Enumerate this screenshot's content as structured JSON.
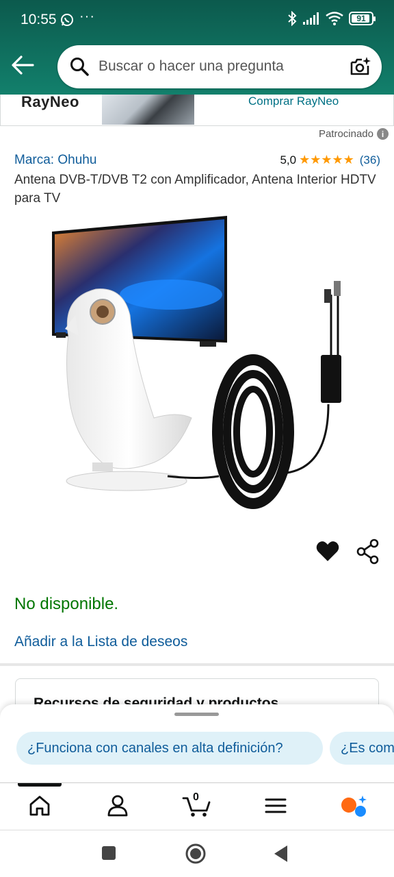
{
  "status": {
    "time": "10:55",
    "dots": "···",
    "battery": "91"
  },
  "search": {
    "placeholder": "Buscar o hacer una pregunta"
  },
  "ad": {
    "brand_logo": "RayNeo",
    "shop_link": "Comprar RayNeo"
  },
  "sponsored": {
    "label": "Patrocinado",
    "info": "i"
  },
  "product": {
    "brand": "Marca: Ohuhu",
    "rating_value": "5,0",
    "stars": "★★★★★",
    "rating_count": "(36)",
    "title": "Antena DVB-T/DVB T2 con Amplificador, Antena Interior HDTV para TV",
    "availability": "No disponible.",
    "wishlist": "Añadir a la Lista de deseos"
  },
  "card": {
    "title": "Recursos de seguridad y productos"
  },
  "suggestions": [
    "¿Funciona con canales en alta definición?",
    "¿Es com"
  ],
  "nav": {
    "cart_count": "0"
  },
  "colors": {
    "accent": "#0f5c9a",
    "success": "#007600",
    "header": "#0c5a4d",
    "star": "#ff9900"
  },
  "icons": [
    "whatsapp-icon",
    "bluetooth-icon",
    "signal-icon",
    "wifi-icon",
    "battery-icon",
    "back-arrow-icon",
    "search-icon",
    "camera-icon",
    "info-icon",
    "heart-icon",
    "share-icon",
    "home-icon",
    "account-icon",
    "cart-icon",
    "menu-icon",
    "assistant-icon"
  ]
}
